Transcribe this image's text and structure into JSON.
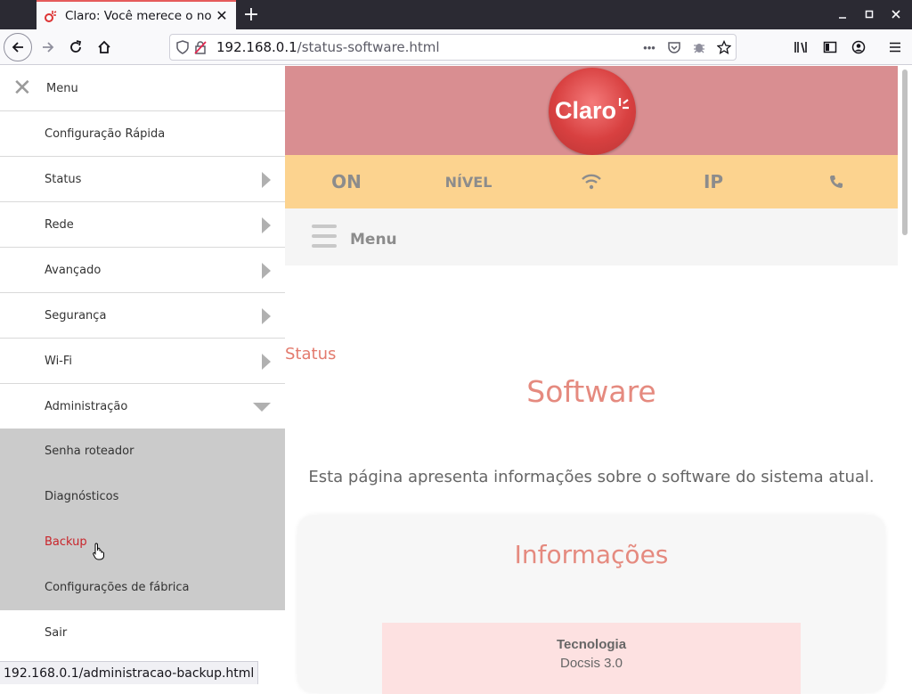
{
  "browser": {
    "tab_title": "Claro: Você merece o no",
    "url_host": "192.168.0.1",
    "url_path": "/status-software.html",
    "status_link": "192.168.0.1/administracao-backup.html"
  },
  "side_menu": {
    "title": "Menu",
    "items": [
      {
        "label": "Configuração Rápida"
      },
      {
        "label": "Status"
      },
      {
        "label": "Rede"
      },
      {
        "label": "Avançado"
      },
      {
        "label": "Segurança"
      },
      {
        "label": "Wi-Fi"
      },
      {
        "label": "Administração"
      }
    ],
    "sub_items": [
      {
        "label": "Senha roteador"
      },
      {
        "label": "Diagnósticos"
      },
      {
        "label": "Backup"
      },
      {
        "label": "Configurações de fábrica"
      }
    ],
    "exit": "Sair"
  },
  "header": {
    "logo_text": "Claro"
  },
  "statusbar": {
    "on": "ON",
    "level": "NÍVEL",
    "ip": "IP"
  },
  "menubar": {
    "label": "Menu"
  },
  "content": {
    "breadcrumb": "Status",
    "title": "Software",
    "description": "Esta página apresenta informações sobre o software do sistema atual.",
    "card_title": "Informações",
    "info_label": "Tecnologia",
    "info_value": "Docsis 3.0"
  },
  "colors": {
    "header_bg": "#d98e91",
    "statusbar_bg": "#fcd38f",
    "accent": "#e58a7f",
    "active_menu": "#c9252b"
  }
}
